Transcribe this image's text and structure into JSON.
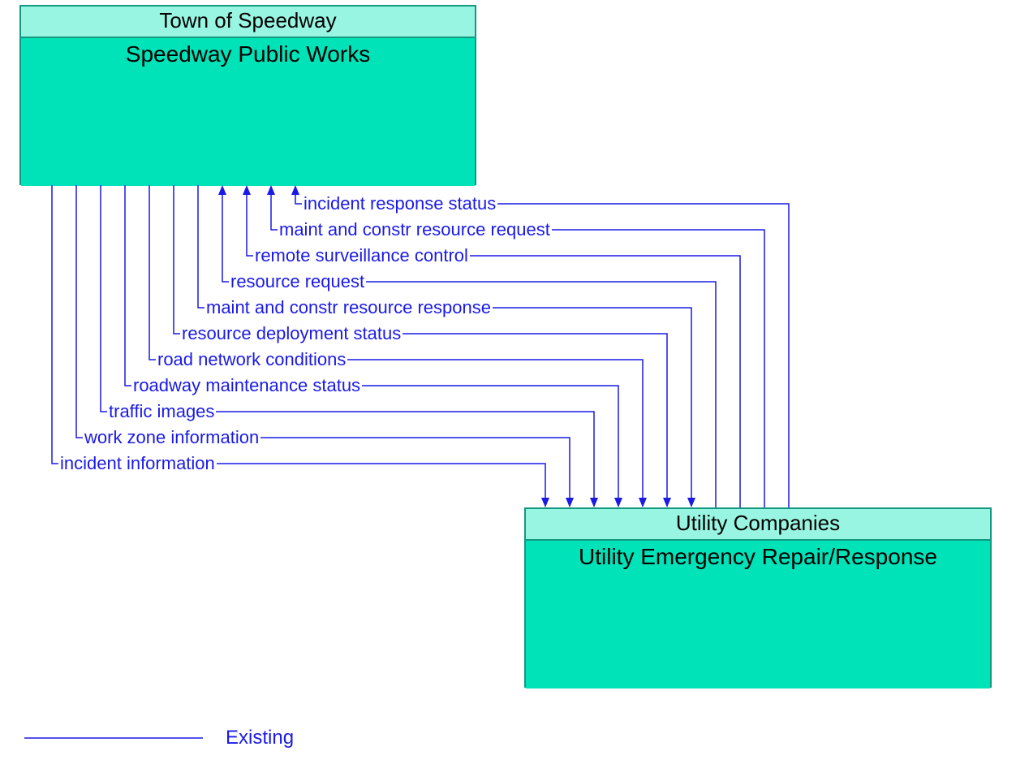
{
  "top_entity": {
    "owner": "Town of Speedway",
    "name": "Speedway Public Works"
  },
  "bottom_entity": {
    "owner": "Utility Companies",
    "name": "Utility Emergency Repair/Response"
  },
  "flows_to_bottom": [
    "incident information",
    "work zone information",
    "traffic images",
    "roadway maintenance status",
    "road network conditions",
    "resource deployment status",
    "maint and constr resource response"
  ],
  "flows_to_top": [
    "resource request",
    "remote surveillance control",
    "maint and constr resource request",
    "incident response status"
  ],
  "legend": {
    "label": "Existing"
  },
  "colors": {
    "line": "#1a1ae6",
    "box_border": "#129880",
    "box_header": "#98f5e1",
    "box_body": "#00e2b8"
  }
}
